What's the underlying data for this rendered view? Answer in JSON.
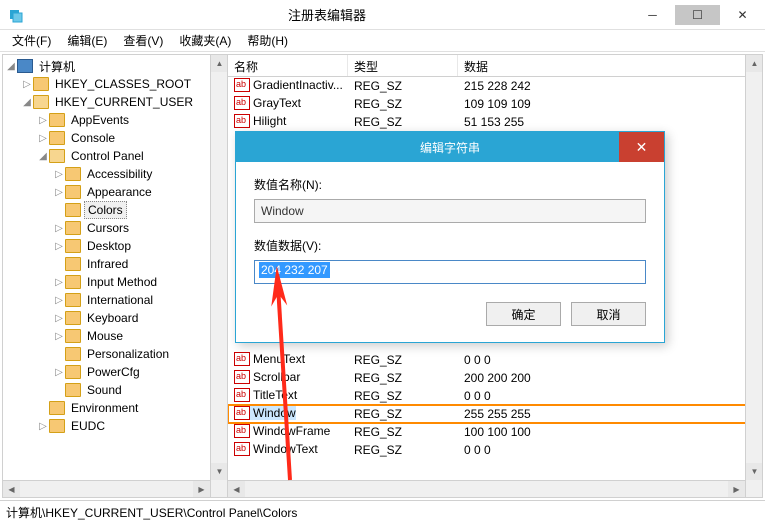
{
  "window": {
    "title": "注册表编辑器"
  },
  "menu": {
    "file": "文件(F)",
    "edit": "编辑(E)",
    "view": "查看(V)",
    "favorites": "收藏夹(A)",
    "help": "帮助(H)"
  },
  "tree": {
    "root": "计算机",
    "hkcr": "HKEY_CLASSES_ROOT",
    "hkcu": "HKEY_CURRENT_USER",
    "items": [
      "AppEvents",
      "Console",
      "Control Panel",
      "Accessibility",
      "Appearance",
      "Colors",
      "Cursors",
      "Desktop",
      "Infrared",
      "Input Method",
      "International",
      "Keyboard",
      "Mouse",
      "Personalization",
      "PowerCfg",
      "Sound"
    ],
    "env": "Environment",
    "eudc": "EUDC"
  },
  "columns": {
    "name": "名称",
    "type": "类型",
    "data": "数据"
  },
  "rows": [
    {
      "name": "GradientInactiv...",
      "type": "REG_SZ",
      "data": "215 228 242"
    },
    {
      "name": "GrayText",
      "type": "REG_SZ",
      "data": "109 109 109"
    },
    {
      "name": "Hilight",
      "type": "REG_SZ",
      "data": "51 153 255"
    },
    {
      "name": "MenuText",
      "type": "REG_SZ",
      "data": "0 0 0"
    },
    {
      "name": "Scrollbar",
      "type": "REG_SZ",
      "data": "200 200 200"
    },
    {
      "name": "TitleText",
      "type": "REG_SZ",
      "data": "0 0 0"
    },
    {
      "name": "Window",
      "type": "REG_SZ",
      "data": "255 255 255",
      "hl": true
    },
    {
      "name": "WindowFrame",
      "type": "REG_SZ",
      "data": "100 100 100"
    },
    {
      "name": "WindowText",
      "type": "REG_SZ",
      "data": "0 0 0"
    }
  ],
  "dialog": {
    "title": "编辑字符串",
    "name_label": "数值名称(N):",
    "name_value": "Window",
    "data_label": "数值数据(V):",
    "data_value": "204 232 207",
    "ok": "确定",
    "cancel": "取消"
  },
  "status": "计算机\\HKEY_CURRENT_USER\\Control Panel\\Colors"
}
